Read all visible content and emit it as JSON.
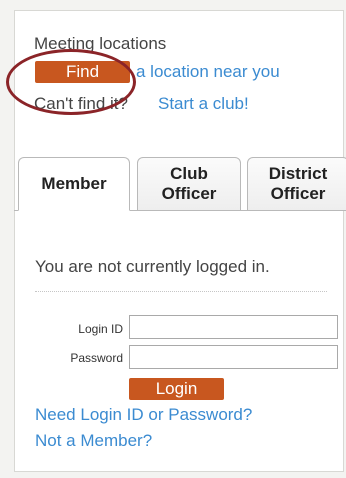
{
  "meeting": {
    "heading": "Meeting locations",
    "find_button": "Find",
    "near_link": "a location near you",
    "cant_find": "Can't find it?",
    "start_link": "Start a club!"
  },
  "tabs": [
    {
      "line1": "Member",
      "line2": ""
    },
    {
      "line1": "Club",
      "line2": "Officer"
    },
    {
      "line1": "District",
      "line2": "Officer"
    }
  ],
  "login": {
    "status": "You are not currently logged in.",
    "loginid_label": "Login ID",
    "password_label": "Password",
    "login_button": "Login",
    "help_link": "Need Login ID or Password?",
    "member_link": "Not a Member?"
  },
  "colors": {
    "accent": "#c8571f",
    "link": "#3b8bd1",
    "annotation_circle": "#8b2428"
  }
}
